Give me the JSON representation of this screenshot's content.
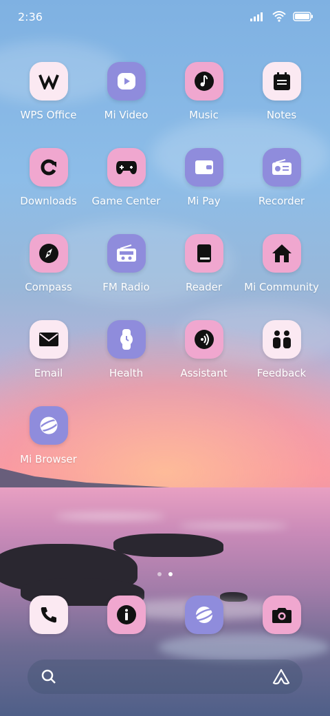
{
  "status": {
    "time": "2:36"
  },
  "apps": [
    {
      "label": "WPS Office",
      "icon": "wps-icon",
      "color": "white"
    },
    {
      "label": "Mi Video",
      "icon": "play-icon",
      "color": "purple"
    },
    {
      "label": "Music",
      "icon": "music-note-icon",
      "color": "pink"
    },
    {
      "label": "Notes",
      "icon": "notes-icon",
      "color": "white"
    },
    {
      "label": "Downloads",
      "icon": "download-icon",
      "color": "pink"
    },
    {
      "label": "Game Center",
      "icon": "gamepad-icon",
      "color": "pink"
    },
    {
      "label": "Mi Pay",
      "icon": "wallet-icon",
      "color": "purple"
    },
    {
      "label": "Recorder",
      "icon": "recorder-icon",
      "color": "purple"
    },
    {
      "label": "Compass",
      "icon": "compass-icon",
      "color": "pink"
    },
    {
      "label": "FM Radio",
      "icon": "radio-icon",
      "color": "purple"
    },
    {
      "label": "Reader",
      "icon": "book-icon",
      "color": "pink"
    },
    {
      "label": "Mi Community",
      "icon": "home-icon",
      "color": "pink"
    },
    {
      "label": "Email",
      "icon": "mail-icon",
      "color": "white"
    },
    {
      "label": "Health",
      "icon": "watch-icon",
      "color": "purple"
    },
    {
      "label": "Assistant",
      "icon": "assistant-icon",
      "color": "pink"
    },
    {
      "label": "Feedback",
      "icon": "feedback-icon",
      "color": "white"
    },
    {
      "label": "Mi Browser",
      "icon": "browser-icon",
      "color": "purple"
    }
  ],
  "dock": [
    {
      "name": "phone-icon",
      "color": "white"
    },
    {
      "name": "info-icon",
      "color": "pink"
    },
    {
      "name": "browser-icon",
      "color": "purple"
    },
    {
      "name": "camera-icon",
      "color": "pink"
    }
  ],
  "pager": {
    "pages": 2,
    "active": 1
  }
}
